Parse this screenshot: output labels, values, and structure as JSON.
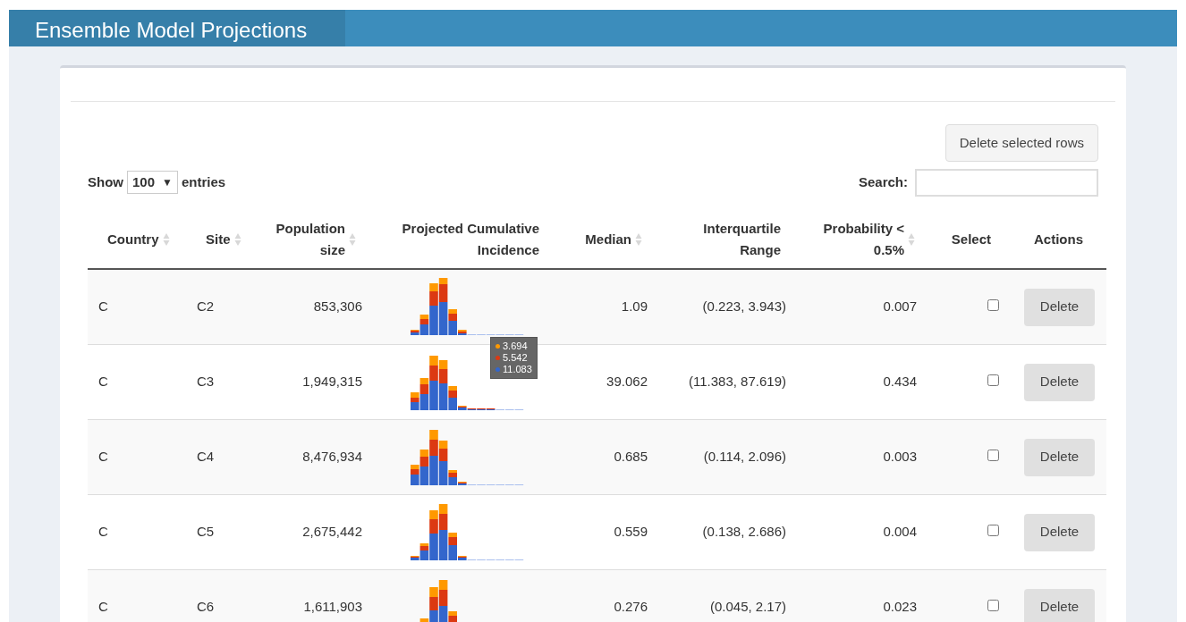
{
  "header": {
    "title": "Ensemble Model Projections"
  },
  "toolbar": {
    "delete_selected": "Delete selected rows",
    "show_label": "Show",
    "page_size": "100",
    "page_size_caret": "▼",
    "entries_label": "entries",
    "search_label": "Search:"
  },
  "table": {
    "columns": [
      {
        "label": "Country",
        "sortable": true
      },
      {
        "label": "Site",
        "sortable": true
      },
      {
        "label": "Population size",
        "sortable": true
      },
      {
        "label": "Projected Cumulative Incidence",
        "sortable": false
      },
      {
        "label": "Median",
        "sortable": true
      },
      {
        "label": "Interquartile Range",
        "sortable": false
      },
      {
        "label": "Probability < 0.5%",
        "sortable": true
      },
      {
        "label": "Select",
        "sortable": false
      },
      {
        "label": "Actions",
        "sortable": false
      }
    ],
    "rows": [
      {
        "country": "C",
        "site": "C2",
        "population": "853,306",
        "median": "1.09",
        "iqr": "(0.223, 3.943)",
        "probability": "0.007",
        "checked": false,
        "action": "Delete"
      },
      {
        "country": "C",
        "site": "C3",
        "population": "1,949,315",
        "median": "39.062",
        "iqr": "(11.383, 87.619)",
        "probability": "0.434",
        "checked": false,
        "action": "Delete",
        "tooltip": [
          {
            "value": "3.694",
            "color": "#ff9900"
          },
          {
            "value": "5.542",
            "color": "#dc3912"
          },
          {
            "value": "11.083",
            "color": "#3366cc"
          }
        ]
      },
      {
        "country": "C",
        "site": "C4",
        "population": "8,476,934",
        "median": "0.685",
        "iqr": "(0.114, 2.096)",
        "probability": "0.003",
        "checked": false,
        "action": "Delete"
      },
      {
        "country": "C",
        "site": "C5",
        "population": "2,675,442",
        "median": "0.559",
        "iqr": "(0.138, 2.686)",
        "probability": "0.004",
        "checked": false,
        "action": "Delete"
      },
      {
        "country": "C",
        "site": "C6",
        "population": "1,611,903",
        "median": "0.276",
        "iqr": "(0.045, 2.17)",
        "probability": "0.023",
        "checked": false,
        "action": "Delete"
      }
    ]
  }
}
